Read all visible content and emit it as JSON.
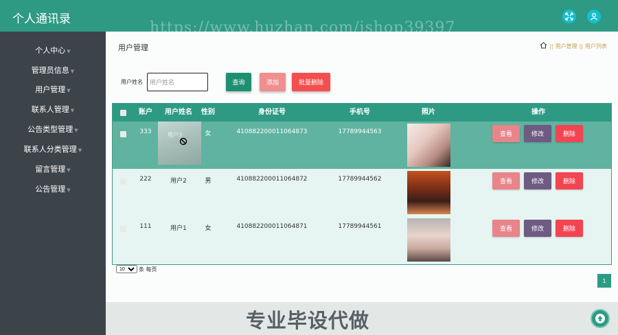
{
  "app": {
    "title": "个人通讯录"
  },
  "watermark": "https://www.huzhan.com/ishop39397",
  "colors": {
    "primary": "#2e9a84",
    "sidebar": "#3c4449",
    "btn_query": "#1f8f72",
    "btn_add": "#f08f8f",
    "btn_batch_delete": "#f34f4f",
    "btn_view": "#e8848a",
    "btn_edit": "#6e5a82",
    "btn_delete": "#f34452"
  },
  "sidebar": {
    "items": [
      {
        "label": "个人中心"
      },
      {
        "label": "管理员信息"
      },
      {
        "label": "用户管理"
      },
      {
        "label": "联系人管理"
      },
      {
        "label": "公告类型管理"
      },
      {
        "label": "联系人分类管理"
      },
      {
        "label": "留言管理"
      },
      {
        "label": "公告管理"
      }
    ]
  },
  "page": {
    "title": "用户管理",
    "breadcrumb": {
      "sep": "||",
      "level1": "用户管理",
      "level2": "用户列表"
    }
  },
  "search": {
    "label": "用户姓名",
    "placeholder": "用户姓名",
    "value": ""
  },
  "toolbar": {
    "query_label": "查询",
    "add_label": "添加",
    "batch_delete_label": "批量删除"
  },
  "table": {
    "headers": {
      "account": "账户",
      "name": "用户姓名",
      "gender": "性别",
      "id_card": "身份证号",
      "phone": "手机号",
      "photo": "照片",
      "actions": "操作"
    },
    "actions": {
      "view": "查看",
      "edit": "修改",
      "delete": "删除"
    },
    "rows": [
      {
        "account": "333",
        "name": "用户3",
        "gender": "女",
        "id_card": "410882200011064873",
        "phone": "17789944563"
      },
      {
        "account": "222",
        "name": "用户2",
        "gender": "男",
        "id_card": "410882200011064872",
        "phone": "17789944562"
      },
      {
        "account": "111",
        "name": "用户1",
        "gender": "女",
        "id_card": "410882200011064871",
        "phone": "17789944561"
      }
    ]
  },
  "pagination": {
    "page_size": "10",
    "per_page_text": "条 每页",
    "current_page": "1"
  },
  "footer": {
    "text": "专业毕设代做"
  }
}
